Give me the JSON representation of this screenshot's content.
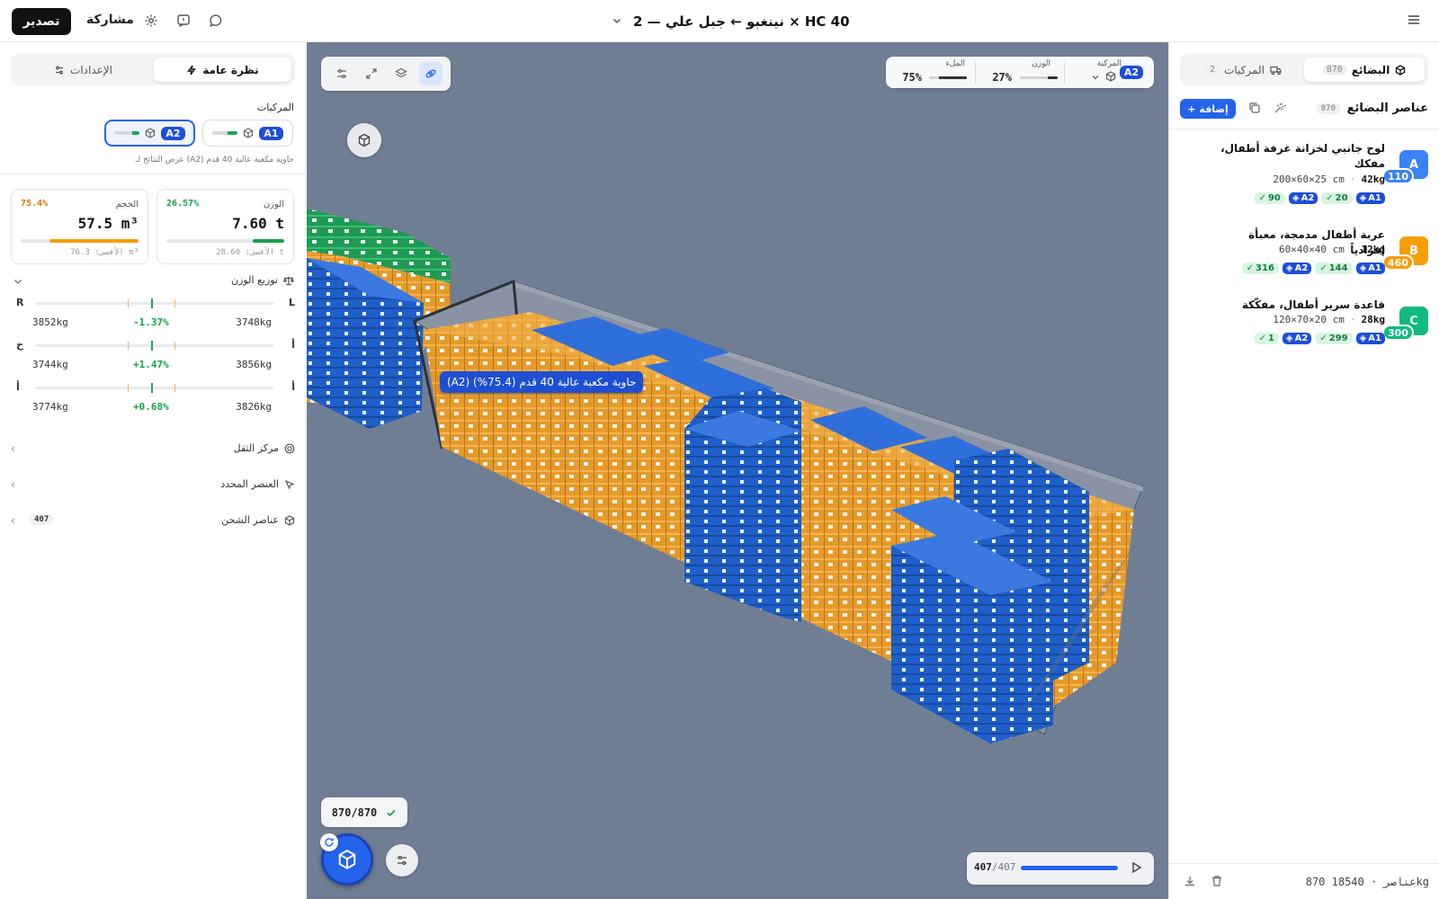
{
  "header": {
    "title": "نينغبو ← جبل علي — 2 × HC 40",
    "export_label": "تصدير",
    "share_label": "مشاركة"
  },
  "left_panel": {
    "tabs": [
      {
        "label": "نظرة عامة",
        "active": true
      },
      {
        "label": "الإعدادات",
        "active": false
      }
    ],
    "vehicles_label": "المركبات",
    "vehicles": [
      {
        "id": "A1",
        "fill": 0.75,
        "selected": false
      },
      {
        "id": "A2",
        "fill": 0.75,
        "selected": true
      }
    ],
    "vehicles_caption": "عرض النتائج لـ (A2) حاوية مكعبة عالية 40 قدم",
    "weight_card": {
      "label": "الوزن",
      "value": "7.60 t",
      "pct": "26.57%",
      "max": "الأقصى: 28.60 t",
      "fill": 0.2657
    },
    "volume_card": {
      "label": "الحجم",
      "value": "57.5 m³",
      "pct": "75.4%",
      "max": "الأقصى: 76.3 m³",
      "fill": 0.754
    },
    "weight_distribution": {
      "title": "توزيع الوزن",
      "rows": [
        {
          "side_a": "L",
          "side_b": "R",
          "kg_a": "3748kg",
          "kg_b": "3852kg",
          "deviation": "-1.37%"
        },
        {
          "side_a": "أ",
          "side_b": "خ",
          "kg_a": "3856kg",
          "kg_b": "3744kg",
          "deviation": "+1.47%"
        },
        {
          "side_a": "أ",
          "side_b": "أ",
          "kg_a": "3826kg",
          "kg_b": "3774kg",
          "deviation": "+0.68%"
        }
      ]
    },
    "sections": {
      "center_of_gravity": "مركز الثقل",
      "selected_item": "العنصر المحدد",
      "shipping_items": "عناصر الشحن",
      "shipping_items_count": "407"
    }
  },
  "viewport": {
    "summary": {
      "vehicle_label": "المركبة",
      "vehicle_id": "A2",
      "weight_label": "الوزن",
      "weight_value": "27%",
      "weight_fill": 0.27,
      "fill_label": "الملء",
      "fill_value": "75%",
      "fill_fill": 0.75
    },
    "tooltip": "(A2) حاوية مكعبة عالية 40 قدم (75.4%)",
    "placed_count": "870/870",
    "progress": {
      "current": "407",
      "total": "407",
      "fill": 1.0
    }
  },
  "right_panel": {
    "tabs": [
      {
        "label": "المركبات",
        "count": "2",
        "active": false
      },
      {
        "label": "البضائع",
        "count": "870",
        "active": true
      }
    ],
    "cargo_title": "عناصر البضائع",
    "cargo_count": "870",
    "add_label": "إضافة",
    "items": [
      {
        "letter": "A",
        "qty": "110",
        "color": "#3b82f6",
        "name": "لوح جانبي لخزانة غرفة أطفال، مفكك",
        "weight": "42kg",
        "dims": "200×60×25 cm",
        "a1_count": "20",
        "a2_count": "90"
      },
      {
        "letter": "B",
        "qty": "460",
        "color": "#f59e0b",
        "name": "عربة أطفال مدمجة، معبأة إفرادياً",
        "weight": "12kg",
        "dims": "60×40×40 cm",
        "a1_count": "144",
        "a2_count": "316"
      },
      {
        "letter": "C",
        "qty": "300",
        "color": "#10b981",
        "name": "قاعدة سرير أطفال، مفكّكة",
        "weight": "28kg",
        "dims": "120×70×20 cm",
        "a1_count": "299",
        "a2_count": "1"
      }
    ],
    "footer_summary": "870 عناصر · 18540kg"
  }
}
